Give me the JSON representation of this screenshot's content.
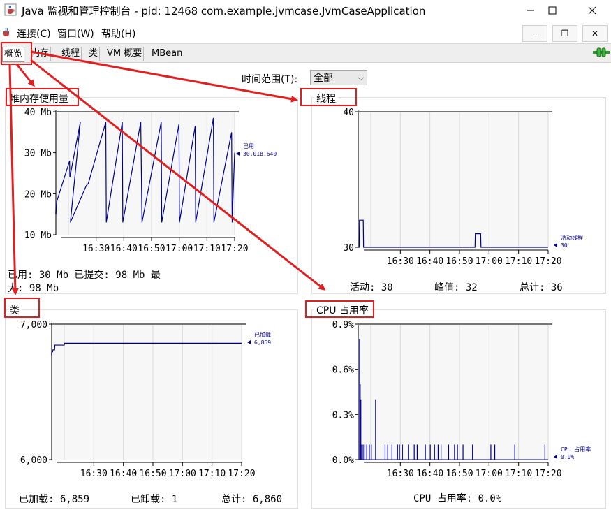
{
  "window": {
    "title": "Java 监视和管理控制台 - pid: 12468 com.example.jvmcase.JvmCaseApplication",
    "app_icon": "java-cup-icon"
  },
  "menu": {
    "items": [
      "连接(C)",
      "窗口(W)",
      "帮助(H)"
    ]
  },
  "tabs": [
    "概览",
    "内存",
    "线程",
    "类",
    "VM 概要",
    "MBean"
  ],
  "active_tab": "概览",
  "connection_icon": "connected-plug-icon",
  "time_range": {
    "label": "时间范围(T):",
    "value": "全部"
  },
  "colors": {
    "series": "#00008b",
    "highlight": "#e02020"
  },
  "panels": {
    "heap": {
      "title": "堆内存使用量",
      "stats_line1": "已用:  30  Mb          已提交:  98  Mb          最",
      "stats_line2": "大:  98  Mb"
    },
    "threads": {
      "title": "线程",
      "stats": {
        "active": "活动:  30",
        "peak": "峰值:  32",
        "total": "总计:  36"
      }
    },
    "classes": {
      "title": "类",
      "stats": {
        "loaded": "已加载:  6,859",
        "unloaded": "已卸载:  1",
        "total": "总计:  6,860"
      }
    },
    "cpu": {
      "title": "CPU 占用率",
      "stats": "CPU 占用率: 0.0%"
    }
  },
  "chart_data": [
    {
      "type": "line",
      "name": "heap",
      "ylabels": [
        "40 Mb",
        "30 Mb",
        "20 Mb",
        "10 Mb"
      ],
      "ylim": [
        10,
        40
      ],
      "x_ticks": [
        "16:30",
        "16:40",
        "16:50",
        "17:00",
        "17:10",
        "17:20"
      ],
      "legend_name": "已用",
      "legend_value": "30,018,640",
      "series": [
        {
          "name": "已用",
          "x": [
            0,
            0.3,
            5.5,
            5.6,
            9.8,
            5.8,
            12.2,
            13,
            20,
            20.2,
            26.6,
            26.8,
            34.0,
            34.5,
            42.2,
            42.4,
            49.3,
            49.5,
            55.8,
            56,
            63.1,
            63.3,
            70.4,
            70.6,
            71.6
          ],
          "y": [
            15,
            18,
            28,
            24,
            37.5,
            13,
            22,
            22.5,
            37.5,
            13,
            37.5,
            13,
            37.5,
            13,
            37.5,
            13,
            37,
            13,
            36.5,
            13,
            38.5,
            13,
            35,
            13,
            30
          ]
        }
      ]
    },
    {
      "type": "line",
      "name": "threads",
      "ylabels": [
        "40",
        "30"
      ],
      "ylim": [
        30,
        40
      ],
      "x_ticks": [
        "16:30",
        "16:40",
        "16:50",
        "17:00",
        "17:10",
        "17:20"
      ],
      "legend_name": "活动线程",
      "legend_value": "30",
      "series": [
        {
          "name": "活动线程",
          "x": [
            0,
            0.3,
            0.4,
            1.6,
            1.7,
            37.2,
            37.3,
            39.0,
            39.1,
            60.5
          ],
          "y": [
            30,
            30,
            32,
            32,
            30,
            30,
            31,
            31,
            30,
            30
          ]
        }
      ]
    },
    {
      "type": "line",
      "name": "classes",
      "ylabels": [
        "7,000",
        "6,000"
      ],
      "ylim": [
        6000,
        7000
      ],
      "x_ticks": [
        "16:30",
        "16:40",
        "16:50",
        "17:00",
        "17:10",
        "17:20"
      ],
      "legend_name": "已加载",
      "legend_value": "6,859",
      "series": [
        {
          "name": "已加载",
          "x": [
            0,
            0.1,
            0.3,
            0.4,
            0.9,
            1.0,
            3.9,
            4.0,
            59
          ],
          "y": [
            6770,
            6795,
            6795,
            6810,
            6810,
            6845,
            6845,
            6859,
            6859
          ]
        }
      ]
    },
    {
      "type": "line",
      "name": "cpu",
      "ylabels": [
        "0.9%",
        "0.6%",
        "0.3%",
        "0.0%"
      ],
      "ylim": [
        0,
        0.9
      ],
      "x_ticks": [
        "16:30",
        "16:40",
        "16:50",
        "17:00",
        "17:10",
        "17:20"
      ],
      "legend_name": "CPU 占用率",
      "legend_value": "0.0%",
      "series": [
        {
          "name": "CPU 占用率",
          "spikes": [
            [
              0.4,
              0.8
            ],
            [
              0.6,
              0.5
            ],
            [
              0.8,
              0.4
            ],
            [
              1.1,
              0.1
            ],
            [
              1.5,
              0.1
            ],
            [
              2.0,
              0.1
            ],
            [
              2.6,
              0.1
            ],
            [
              3.4,
              0.1
            ],
            [
              4.0,
              0.1
            ],
            [
              5.3,
              0.4
            ],
            [
              8.2,
              0.1
            ],
            [
              9.0,
              0.1
            ],
            [
              10.3,
              0.1
            ],
            [
              12.0,
              0.1
            ],
            [
              12.6,
              0.1
            ],
            [
              13.5,
              0.1
            ],
            [
              15.4,
              0.1
            ],
            [
              17.1,
              0.1
            ],
            [
              18.0,
              0.1
            ],
            [
              20.5,
              0.1
            ],
            [
              22.0,
              0.1
            ],
            [
              23.3,
              0.1
            ],
            [
              24.4,
              0.1
            ],
            [
              25.3,
              0.1
            ],
            [
              27.6,
              0.1
            ],
            [
              29.4,
              0.1
            ],
            [
              30.3,
              0.1
            ],
            [
              32.0,
              0.1
            ],
            [
              34.9,
              0.1
            ],
            [
              40.5,
              0.1
            ],
            [
              41.7,
              0.1
            ],
            [
              47.8,
              0.1
            ],
            [
              57.0,
              0.1
            ]
          ]
        }
      ]
    }
  ]
}
